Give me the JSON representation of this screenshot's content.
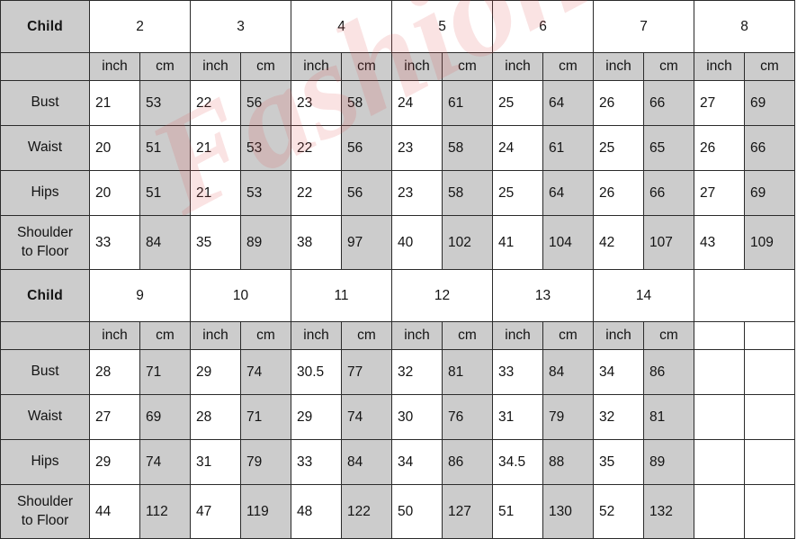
{
  "watermark": {
    "text": "Fashionkkk"
  },
  "units": {
    "inch": "inch",
    "cm": "cm"
  },
  "section_label": "Child",
  "row_labels": {
    "bust": "Bust",
    "waist": "Waist",
    "hips": "Hips",
    "shoulder_to_floor_line1": "Shoulder",
    "shoulder_to_floor_line2": "to Floor"
  },
  "sections": [
    {
      "label": "Child",
      "sizes": [
        "2",
        "3",
        "4",
        "5",
        "6",
        "7",
        "8"
      ],
      "trailing_empty_columns": 0,
      "rows": [
        {
          "label": "Bust",
          "inch": [
            "21",
            "22",
            "23",
            "24",
            "25",
            "26",
            "27"
          ],
          "cm": [
            "53",
            "56",
            "58",
            "61",
            "64",
            "66",
            "69"
          ]
        },
        {
          "label": "Waist",
          "inch": [
            "20",
            "21",
            "22",
            "23",
            "24",
            "25",
            "26"
          ],
          "cm": [
            "51",
            "53",
            "56",
            "58",
            "61",
            "65",
            "66"
          ]
        },
        {
          "label": "Hips",
          "inch": [
            "20",
            "21",
            "22",
            "23",
            "25",
            "26",
            "27"
          ],
          "cm": [
            "51",
            "53",
            "56",
            "58",
            "64",
            "66",
            "69"
          ]
        },
        {
          "label": "Shoulder to Floor",
          "inch": [
            "33",
            "35",
            "38",
            "40",
            "41",
            "42",
            "43"
          ],
          "cm": [
            "84",
            "89",
            "97",
            "102",
            "104",
            "107",
            "109"
          ]
        }
      ]
    },
    {
      "label": "Child",
      "sizes": [
        "9",
        "10",
        "11",
        "12",
        "13",
        "14"
      ],
      "trailing_empty_columns": 2,
      "rows": [
        {
          "label": "Bust",
          "inch": [
            "28",
            "29",
            "30.5",
            "32",
            "33",
            "34"
          ],
          "cm": [
            "71",
            "74",
            "77",
            "81",
            "84",
            "86"
          ]
        },
        {
          "label": "Waist",
          "inch": [
            "27",
            "28",
            "29",
            "30",
            "31",
            "32"
          ],
          "cm": [
            "69",
            "71",
            "74",
            "76",
            "79",
            "81"
          ]
        },
        {
          "label": "Hips",
          "inch": [
            "29",
            "31",
            "33",
            "34",
            "34.5",
            "35"
          ],
          "cm": [
            "74",
            "79",
            "84",
            "86",
            "88",
            "89"
          ]
        },
        {
          "label": "Shoulder to Floor",
          "inch": [
            "44",
            "47",
            "48",
            "50",
            "51",
            "52"
          ],
          "cm": [
            "112",
            "119",
            "122",
            "127",
            "130",
            "132"
          ]
        }
      ]
    }
  ],
  "colors": {
    "header_gray": "#cccccc",
    "cell_gray": "#cccccc",
    "cell_white": "#ffffff",
    "border": "#2b2b2b",
    "child_text": "#585858",
    "text": "#131313"
  }
}
